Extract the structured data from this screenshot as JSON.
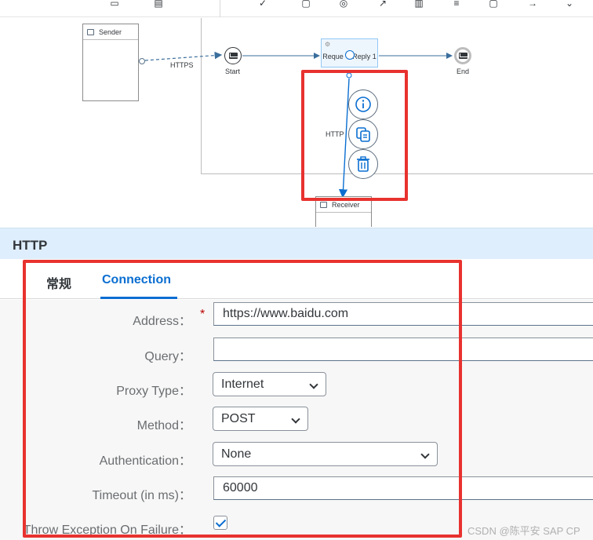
{
  "toolbar": {
    "icons": [
      "copy-icon",
      "paste-icon",
      "check-icon",
      "save-icon",
      "at-icon",
      "arrow-icon",
      "delete-icon",
      "menu-icon",
      "clipboard-icon",
      "export-icon",
      "navigate-icon"
    ]
  },
  "canvas": {
    "sender_label": "Sender",
    "start_label": "Start",
    "end_label": "End",
    "task_label": "Reque ｜Reply 1",
    "https_label": "HTTPS",
    "http_label": "HTTP",
    "receiver_label": "Receiver",
    "context_actions": [
      "info-icon",
      "copy-icon",
      "delete-icon"
    ]
  },
  "panel": {
    "title": "HTTP",
    "tabs": [
      {
        "label": "常规",
        "active": false
      },
      {
        "label": "Connection",
        "active": true
      }
    ]
  },
  "form": {
    "address_label": "Address",
    "address_value": "https://www.baidu.com",
    "query_label": "Query",
    "query_value": "",
    "proxy_label": "Proxy Type",
    "proxy_value": "Internet",
    "method_label": "Method",
    "method_value": "POST",
    "auth_label": "Authentication",
    "auth_value": "None",
    "timeout_label": "Timeout (in ms)",
    "timeout_value": "60000",
    "throw_label": "Throw Exception On Failure",
    "throw_checked": true,
    "colon": "："
  },
  "watermark": "CSDN @陈平安 SAP CP",
  "colors": {
    "accent": "#0a6ed1",
    "highlight": "#e8322f",
    "panel_header": "#dfeefc",
    "required": "#bb0000"
  }
}
